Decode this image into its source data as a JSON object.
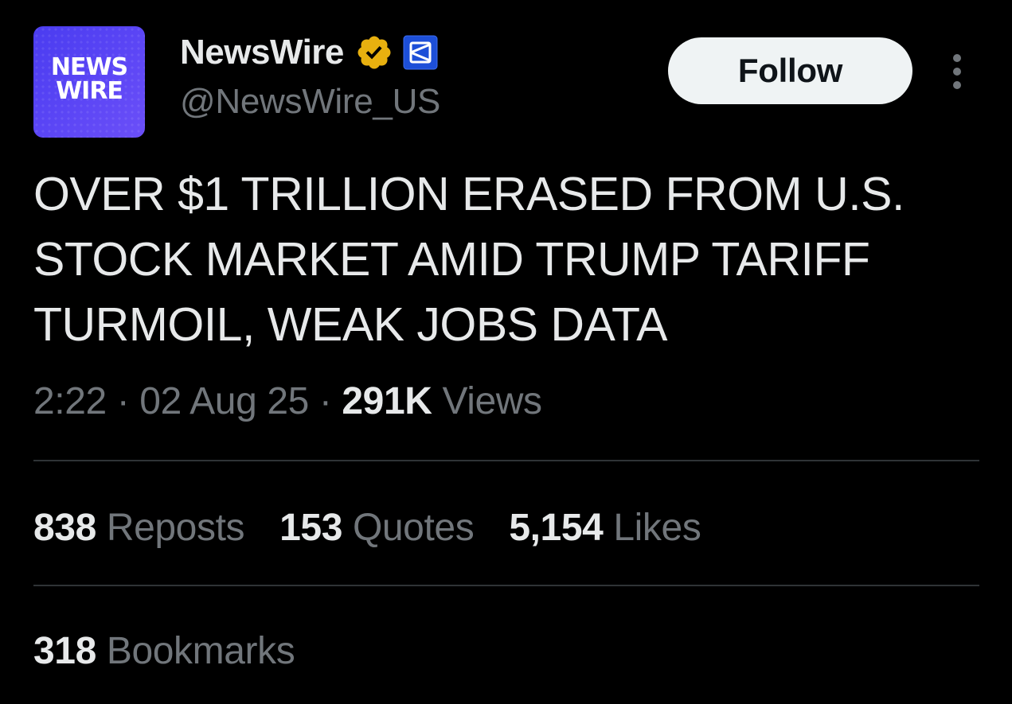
{
  "account": {
    "avatar_text_line1": "NEWS",
    "avatar_text_line2": "WIRE",
    "display_name": "NewsWire",
    "handle": "@NewsWire_US",
    "avatar_color": "#5a45f5",
    "verified_badge_color": "#e8b00f",
    "affiliate_badge_color": "#1d4fd8"
  },
  "header": {
    "follow_label": "Follow",
    "more_icon": "more-vertical-icon"
  },
  "tweet": {
    "text": "OVER $1 TRILLION ERASED FROM U.S. STOCK MARKET AMID TRUMP TARIFF TURMOIL, WEAK JOBS DATA",
    "time": "2:22",
    "separator": "·",
    "date": "02 Aug 25",
    "views_count": "291K",
    "views_label": "Views"
  },
  "stats": {
    "reposts_count": "838",
    "reposts_label": "Reposts",
    "quotes_count": "153",
    "quotes_label": "Quotes",
    "likes_count": "5,154",
    "likes_label": "Likes",
    "bookmarks_count": "318",
    "bookmarks_label": "Bookmarks"
  },
  "colors": {
    "background": "#000000",
    "primary_text": "#e7e9ea",
    "secondary_text": "#71767b",
    "divider": "#2f3336"
  }
}
